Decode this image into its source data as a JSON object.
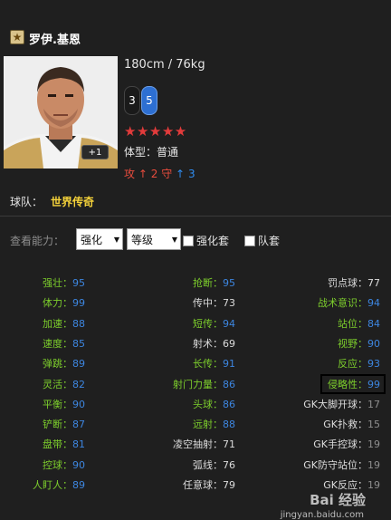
{
  "player": {
    "name": "罗伊.基恩",
    "height_weight": "180cm / 76kg",
    "badge": "+1",
    "left_foot": "3",
    "right_foot": "5",
    "stars": "★★★★★",
    "body_type": "体型：普通",
    "attack_label": "攻",
    "attack_value": "2",
    "defense_label": "守",
    "defense_value": "3"
  },
  "team": {
    "label": "球队：",
    "value": "世界传奇"
  },
  "controls": {
    "view_label": "查看能力：",
    "select1": "强化",
    "select2": "等级",
    "check1": "强化套",
    "check2": "队套"
  },
  "attributes": {
    "col1": [
      {
        "label": "强壮：",
        "value": "95"
      },
      {
        "label": "体力：",
        "value": "99"
      },
      {
        "label": "加速：",
        "value": "88"
      },
      {
        "label": "速度：",
        "value": "85"
      },
      {
        "label": "弹跳：",
        "value": "89"
      },
      {
        "label": "灵活：",
        "value": "82"
      },
      {
        "label": "平衡：",
        "value": "90"
      },
      {
        "label": "铲断：",
        "value": "87"
      },
      {
        "label": "盘带：",
        "value": "81"
      },
      {
        "label": "控球：",
        "value": "90"
      },
      {
        "label": "人盯人：",
        "value": "89"
      }
    ],
    "col2": [
      {
        "label": "抢断：",
        "value": "95"
      },
      {
        "label": "传中：",
        "value": "73"
      },
      {
        "label": "短传：",
        "value": "94"
      },
      {
        "label": "射术：",
        "value": "69"
      },
      {
        "label": "长传：",
        "value": "91"
      },
      {
        "label": "射门力量：",
        "value": "86"
      },
      {
        "label": "头球：",
        "value": "86"
      },
      {
        "label": "远射：",
        "value": "88"
      },
      {
        "label": "凌空抽射：",
        "value": "71"
      },
      {
        "label": "弧线：",
        "value": "76"
      },
      {
        "label": "任意球：",
        "value": "79"
      }
    ],
    "col3": [
      {
        "label": "罚点球：",
        "value": "77"
      },
      {
        "label": "战术意识：",
        "value": "94"
      },
      {
        "label": "站位：",
        "value": "84"
      },
      {
        "label": "视野：",
        "value": "90"
      },
      {
        "label": "反应：",
        "value": "93"
      },
      {
        "label": "侵略性：",
        "value": "99"
      },
      {
        "label": "GK大脚开球：",
        "value": "17"
      },
      {
        "label": "GK扑救：",
        "value": "15"
      },
      {
        "label": "GK手控球：",
        "value": "19"
      },
      {
        "label": "GK防守站位：",
        "value": "19"
      },
      {
        "label": "GK反应：",
        "value": "19"
      }
    ]
  },
  "watermark": {
    "main": "Bai 经验",
    "sub": "jingyan.baidu.com"
  },
  "colors": {
    "green": "#7dce2c",
    "blue": "#3d86e0",
    "gold": "#f5d23a",
    "red": "#e23b3b"
  }
}
